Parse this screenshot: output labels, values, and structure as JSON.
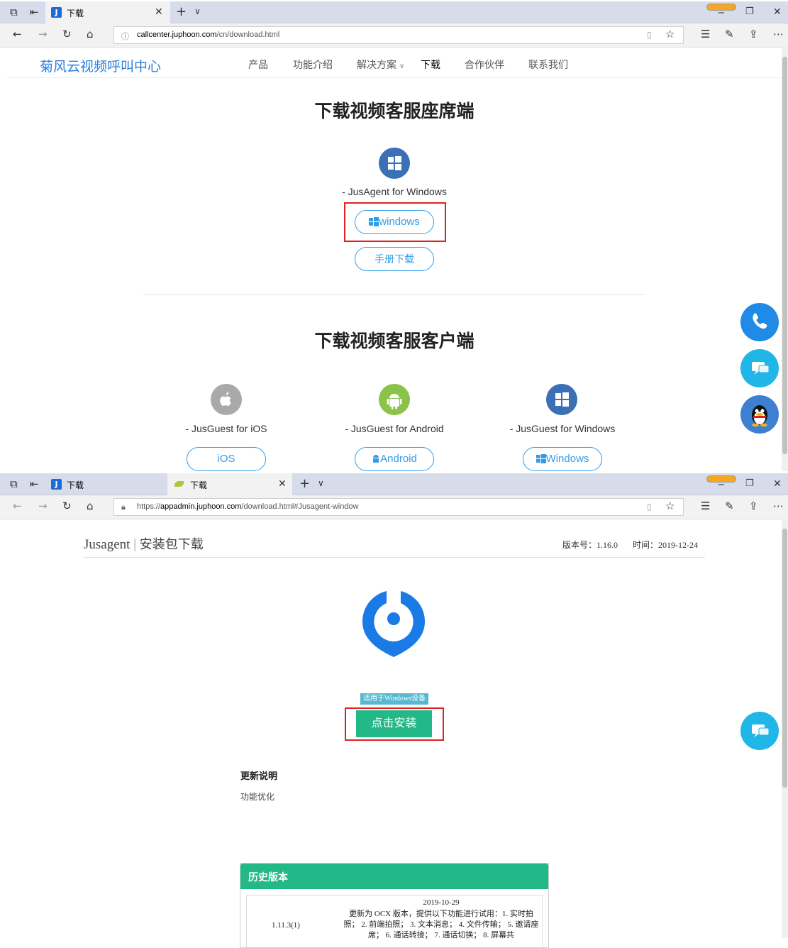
{
  "window1": {
    "tab_title": "下载",
    "url_host": "callcenter.juphoon.com",
    "url_path": "/cn/download.html"
  },
  "site": {
    "logo": "菊风云视频呼叫中心",
    "nav": [
      "产品",
      "功能介绍",
      "解决方案",
      "下载",
      "合作伙伴",
      "联系我们"
    ],
    "active_nav": "下载"
  },
  "agent_section": {
    "title": "下载视频客服座席端",
    "product_label": "- JusAgent for Windows",
    "windows_button": "windows",
    "manual_button": "手册下载"
  },
  "guest_section": {
    "title": "下载视频客服客户端",
    "products": [
      {
        "label": "- JusGuest for iOS",
        "button": "iOS",
        "icon": "apple-icon",
        "color": "#a9a9a9"
      },
      {
        "label": "- JusGuest for Android",
        "button": "Android",
        "icon": "android-icon",
        "color": "#8bc34a"
      },
      {
        "label": "- JusGuest for Windows",
        "button": "Windows",
        "icon": "windows-icon",
        "color": "#3b6fb6"
      }
    ]
  },
  "window2": {
    "tab1_title": "下载",
    "tab2_title": "下载",
    "url_prefix": "https://",
    "url_host": "appadmin.juphoon.com",
    "url_path": "/download.html#Jusagent-window"
  },
  "jusagent": {
    "name": "Jusagent",
    "separator": "|",
    "heading": "安装包下载",
    "version_label": "版本号：",
    "version": "1.16.0",
    "time_label": "时间：",
    "time": "2019-12-24",
    "platform_tag": "适用于Windows设备",
    "install_button": "点击安装",
    "update_title": "更新说明",
    "update_body": "功能优化",
    "history_title": "历史版本",
    "history": [
      {
        "version": "1.11.3(1)",
        "date": "2019-10-29",
        "notes": "更新为 OCX 版本，提供以下功能进行试用：1. 实时拍照； 2. 前端拍照； 3. 文本消息； 4. 文件传输； 5. 邀请座席； 6. 通话转接； 7. 通话切换； 8. 屏幕共"
      }
    ]
  },
  "colors": {
    "brand_blue": "#2a7de1",
    "button_blue": "#2f9ee8",
    "green": "#22b887",
    "highlight_red": "#e02020",
    "phone_float": "#1f8be6",
    "chat_float": "#20b6e8"
  }
}
